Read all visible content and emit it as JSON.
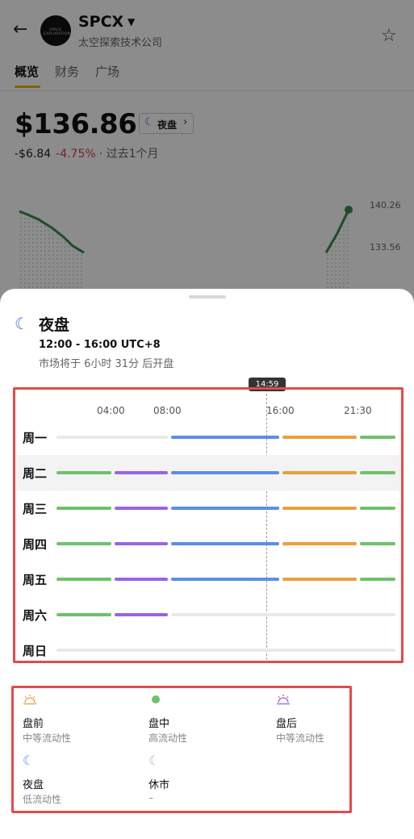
{
  "header": {
    "ticker": "SPCX",
    "company": "太空探索技术公司",
    "logo_text": "SPACE EXPLORATION"
  },
  "tabs": [
    {
      "label": "概览",
      "active": true
    },
    {
      "label": "财务",
      "active": false
    },
    {
      "label": "广场",
      "active": false
    }
  ],
  "quote": {
    "price": "$136.86",
    "session_chip": "夜盘",
    "change_abs": "-$6.84",
    "change_pct": "-4.75%",
    "period": "· 过去1个月"
  },
  "chart": {
    "y_labels": [
      "140.26",
      "133.56"
    ],
    "line_color": "#3a8a4a",
    "series_left": [
      [
        0,
        140.0
      ],
      [
        0.5,
        139.5
      ],
      [
        1.2,
        138.7
      ],
      [
        2.0,
        137.4
      ],
      [
        2.7,
        136.0
      ],
      [
        3.3,
        134.5
      ],
      [
        4.0,
        133.4
      ]
    ],
    "series_right": [
      [
        19.0,
        133.4
      ],
      [
        19.7,
        136.5
      ],
      [
        20.4,
        140.26
      ]
    ]
  },
  "sheet": {
    "title": "夜盘",
    "hours": "12:00 - 16:00 UTC+8",
    "note": "市场将于 6小时 31分 后开盘",
    "now_badge": "14:59"
  },
  "timeline": {
    "time_labels": [
      "04:00",
      "08:00",
      "16:00",
      "21:30"
    ],
    "colors": {
      "pre": "#e8a03c",
      "regular": "#6cc26a",
      "post": "#9b63e6",
      "overnight": "#5b8ee6",
      "closed": "#e9e9e9"
    },
    "days": [
      {
        "label": "周一",
        "segments": [
          "closed",
          "overnight",
          "pre",
          "regular"
        ]
      },
      {
        "label": "周二",
        "segments": [
          "regular",
          "post",
          "overnight",
          "pre",
          "regular"
        ]
      },
      {
        "label": "周三",
        "segments": [
          "regular",
          "post",
          "overnight",
          "pre",
          "regular"
        ]
      },
      {
        "label": "周四",
        "segments": [
          "regular",
          "post",
          "overnight",
          "pre",
          "regular"
        ]
      },
      {
        "label": "周五",
        "segments": [
          "regular",
          "post",
          "overnight",
          "pre",
          "regular"
        ]
      },
      {
        "label": "周六",
        "segments": [
          "regular",
          "post",
          "closed"
        ]
      },
      {
        "label": "周日",
        "segments": [
          "closed"
        ]
      }
    ]
  },
  "legend": {
    "pre": {
      "name": "盘前",
      "desc": "中等流动性",
      "icon": "sunrise-icon",
      "color": "#e8a03c"
    },
    "regular": {
      "name": "盘中",
      "desc": "高流动性",
      "icon": "dot-icon",
      "color": "#6cc26a"
    },
    "post": {
      "name": "盘后",
      "desc": "中等流动性",
      "icon": "sunset-icon",
      "color": "#9b63e6"
    },
    "overnight": {
      "name": "夜盘",
      "desc": "低流动性",
      "icon": "moon-icon",
      "color": "#5b8ee6"
    },
    "closed": {
      "name": "休市",
      "desc": "–",
      "icon": "moon-outline-icon",
      "color": "#b8b8b8"
    }
  }
}
